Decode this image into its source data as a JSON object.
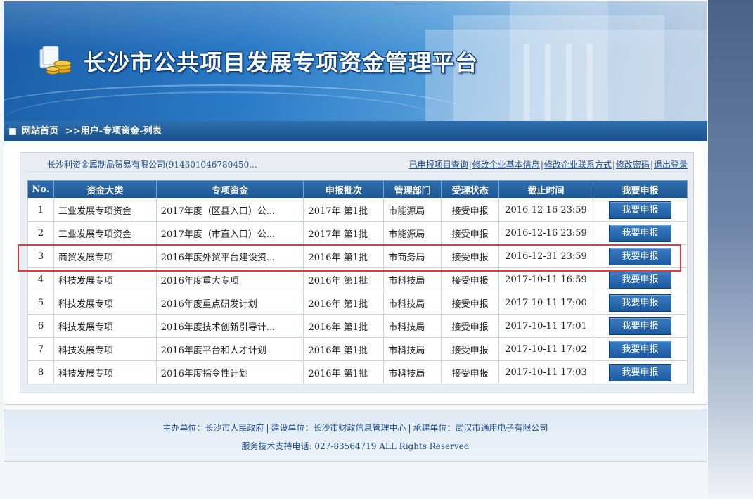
{
  "header": {
    "site_title": "长沙市公共项目发展专项资金管理平台"
  },
  "nav": {
    "home": "网站首页",
    "breadcrumb": ">>用户-专项资金-列表"
  },
  "info": {
    "company": "长沙利资金属制品贸易有限公司(914301046780450...",
    "links": [
      "已申报项目查询",
      "修改企业基本信息",
      "修改企业联系方式",
      "修改密码",
      "退出登录"
    ]
  },
  "table": {
    "headers": [
      "No.",
      "资金大类",
      "专项资金",
      "申报批次",
      "管理部门",
      "受理状态",
      "截止时间",
      "我要申报"
    ],
    "rows": [
      {
        "no": "1",
        "category": "工业发展专项资金",
        "fund": "2017年度（区县入口）公...",
        "batch": "2017年  第1批",
        "dept": "市能源局",
        "status": "接受申报",
        "deadline": "2016-12-16 23:59",
        "action": "我要申报"
      },
      {
        "no": "2",
        "category": "工业发展专项资金",
        "fund": "2017年度（市直入口）公...",
        "batch": "2017年  第1批",
        "dept": "市能源局",
        "status": "接受申报",
        "deadline": "2016-12-16 23:59",
        "action": "我要申报"
      },
      {
        "no": "3",
        "category": "商贸发展专项",
        "fund": "2016年度外贸平台建设资...",
        "batch": "2016年  第1批",
        "dept": "市商务局",
        "status": "接受申报",
        "deadline": "2016-12-31 23:59",
        "action": "我要申报"
      },
      {
        "no": "4",
        "category": "科技发展专项",
        "fund": "2016年度重大专项",
        "batch": "2016年  第1批",
        "dept": "市科技局",
        "status": "接受申报",
        "deadline": "2017-10-11 16:59",
        "action": "我要申报"
      },
      {
        "no": "5",
        "category": "科技发展专项",
        "fund": "2016年度重点研发计划",
        "batch": "2016年  第1批",
        "dept": "市科技局",
        "status": "接受申报",
        "deadline": "2017-10-11 17:00",
        "action": "我要申报"
      },
      {
        "no": "6",
        "category": "科技发展专项",
        "fund": "2016年度技术创新引导计...",
        "batch": "2016年  第1批",
        "dept": "市科技局",
        "status": "接受申报",
        "deadline": "2017-10-11 17:01",
        "action": "我要申报"
      },
      {
        "no": "7",
        "category": "科技发展专项",
        "fund": "2016年度平台和人才计划",
        "batch": "2016年  第1批",
        "dept": "市科技局",
        "status": "接受申报",
        "deadline": "2017-10-11 17:02",
        "action": "我要申报"
      },
      {
        "no": "8",
        "category": "科技发展专项",
        "fund": "2016年度指令性计划",
        "batch": "2016年  第1批",
        "dept": "市科技局",
        "status": "接受申报",
        "deadline": "2017-10-11 17:03",
        "action": "我要申报"
      }
    ]
  },
  "footer": {
    "sponsor": "主办单位：长沙市人民政府",
    "builder": "建设单位：长沙市财政信息管理中心",
    "contractor": "承建单位：武汉市通用电子有限公司",
    "support": "服务技术支持电话: 027-83564719 ALL Rights Reserved"
  },
  "colors": {
    "accent": "#1c5491",
    "highlight": "#e0393e"
  }
}
